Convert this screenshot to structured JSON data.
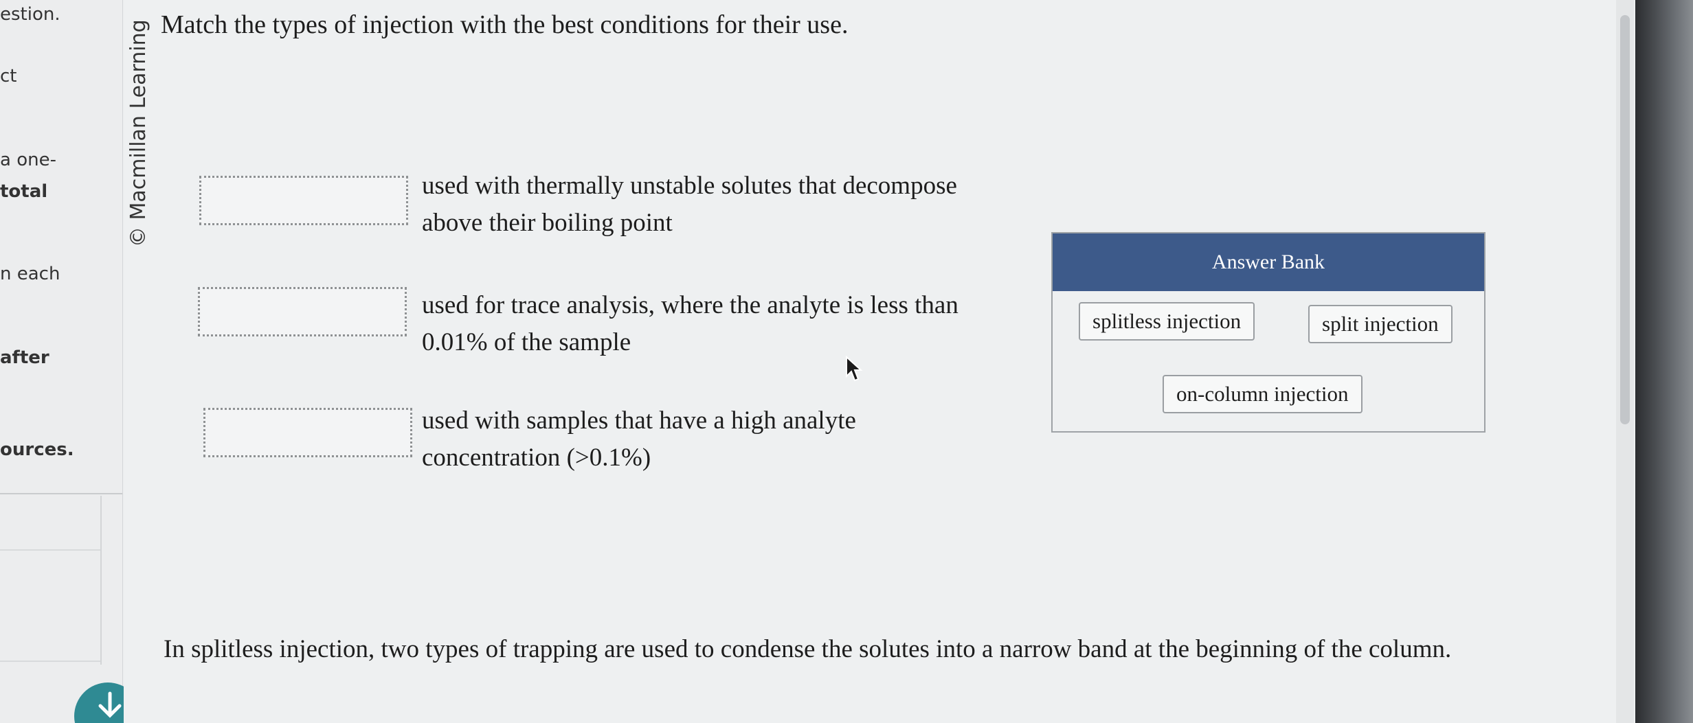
{
  "sidebar": {
    "fragments": [
      {
        "text": "estion.",
        "bold": false
      },
      {
        "text": "ct",
        "bold": false
      },
      {
        "text": "a one-",
        "bold": false
      },
      {
        "text": "total",
        "bold": true
      },
      {
        "text": "n each",
        "bold": false
      },
      {
        "text": "after",
        "bold": true
      },
      {
        "text": "ources.",
        "bold": true
      }
    ]
  },
  "credit": "© Macmillan Learning",
  "question": {
    "title": "Match the types of injection with the best conditions for their use."
  },
  "targets": [
    {
      "line1": "used with thermally unstable solutes that decompose",
      "line2": "above their boiling point"
    },
    {
      "line1": "used for trace analysis, where the analyte is less than",
      "line2": "0.01% of the sample"
    },
    {
      "line1": "used with samples that have a high analyte",
      "line2": "concentration (>0.1%)"
    }
  ],
  "answer_bank": {
    "title": "Answer Bank",
    "items": [
      "splitless injection",
      "split injection",
      "on-column injection"
    ]
  },
  "followup": "In splitless injection, two types of trapping are used to condense the solutes into a narrow band at the beginning of the column."
}
